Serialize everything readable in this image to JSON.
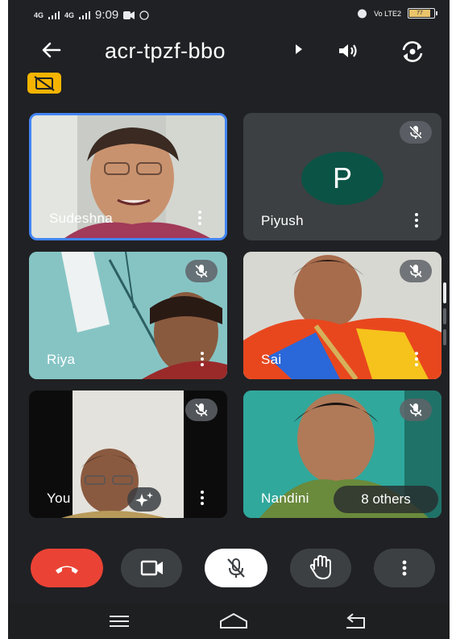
{
  "status_bar": {
    "network_left": "4G",
    "network_right": "4G",
    "time": "9:09",
    "volte": "Vo LTE2",
    "battery": "77"
  },
  "header": {
    "meeting_code": "acr-tpzf-bbo"
  },
  "participants": [
    {
      "name": "Sudeshna",
      "muted": false,
      "selected": true
    },
    {
      "name": "Piyush",
      "avatar_letter": "P",
      "muted": true
    },
    {
      "name": "Riya",
      "muted": true
    },
    {
      "name": "Sai",
      "muted": true
    },
    {
      "name": "You",
      "muted": true
    },
    {
      "name": "Nandini",
      "muted": true
    }
  ],
  "others_label": "8 others",
  "colors": {
    "background": "#202124",
    "end_call": "#ea4335",
    "avatar": "#0b5345",
    "selected_border": "#4285f4",
    "captions_badge": "#f5b400"
  },
  "icons": [
    "back-arrow-icon",
    "caret-right-icon",
    "speaker-icon",
    "camera-flip-icon",
    "captions-off-icon",
    "mic-off-icon",
    "more-vert-icon",
    "end-call-icon",
    "videocam-icon",
    "raise-hand-icon",
    "effects-sparkle-icon",
    "nav-menu-icon",
    "nav-home-icon",
    "nav-back-icon"
  ]
}
